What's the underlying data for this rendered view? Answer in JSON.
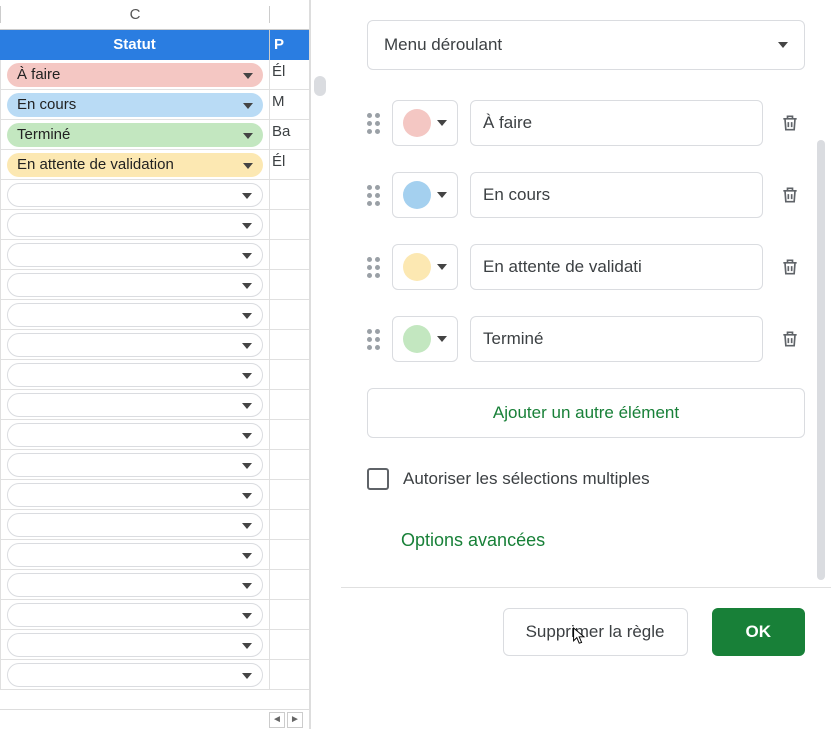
{
  "sheet": {
    "col_letters": {
      "c": "C"
    },
    "headers": {
      "c": "Statut",
      "d": "P"
    },
    "rows": [
      {
        "label": "À faire",
        "chipClass": "chip-pink",
        "d": "Él"
      },
      {
        "label": "En cours",
        "chipClass": "chip-blue",
        "d": "M"
      },
      {
        "label": "Terminé",
        "chipClass": "chip-green",
        "d": "Ba"
      },
      {
        "label": "En attente de validation",
        "chipClass": "chip-yellow",
        "d": "Él"
      },
      {
        "label": "",
        "chipClass": "chip-empty",
        "d": ""
      },
      {
        "label": "",
        "chipClass": "chip-empty",
        "d": ""
      },
      {
        "label": "",
        "chipClass": "chip-empty",
        "d": ""
      },
      {
        "label": "",
        "chipClass": "chip-empty",
        "d": ""
      },
      {
        "label": "",
        "chipClass": "chip-empty",
        "d": ""
      },
      {
        "label": "",
        "chipClass": "chip-empty",
        "d": ""
      },
      {
        "label": "",
        "chipClass": "chip-empty",
        "d": ""
      },
      {
        "label": "",
        "chipClass": "chip-empty",
        "d": ""
      },
      {
        "label": "",
        "chipClass": "chip-empty",
        "d": ""
      },
      {
        "label": "",
        "chipClass": "chip-empty",
        "d": ""
      },
      {
        "label": "",
        "chipClass": "chip-empty",
        "d": ""
      },
      {
        "label": "",
        "chipClass": "chip-empty",
        "d": ""
      },
      {
        "label": "",
        "chipClass": "chip-empty",
        "d": ""
      },
      {
        "label": "",
        "chipClass": "chip-empty",
        "d": ""
      },
      {
        "label": "",
        "chipClass": "chip-empty",
        "d": ""
      },
      {
        "label": "",
        "chipClass": "chip-empty",
        "d": ""
      },
      {
        "label": "",
        "chipClass": "chip-empty",
        "d": ""
      }
    ]
  },
  "panel": {
    "criteria_label": "Menu déroulant",
    "options": [
      {
        "value": "À faire",
        "colorClass": "c-pink"
      },
      {
        "value": "En cours",
        "colorClass": "c-blue"
      },
      {
        "value": "En attente de validati",
        "colorClass": "c-yellow"
      },
      {
        "value": "Terminé",
        "colorClass": "c-green"
      }
    ],
    "add_another": "Ajouter un autre élément",
    "multi_label": "Autoriser les sélections multiples",
    "advanced": "Options avancées",
    "delete_rule": "Supprimer la règle",
    "ok": "OK"
  }
}
